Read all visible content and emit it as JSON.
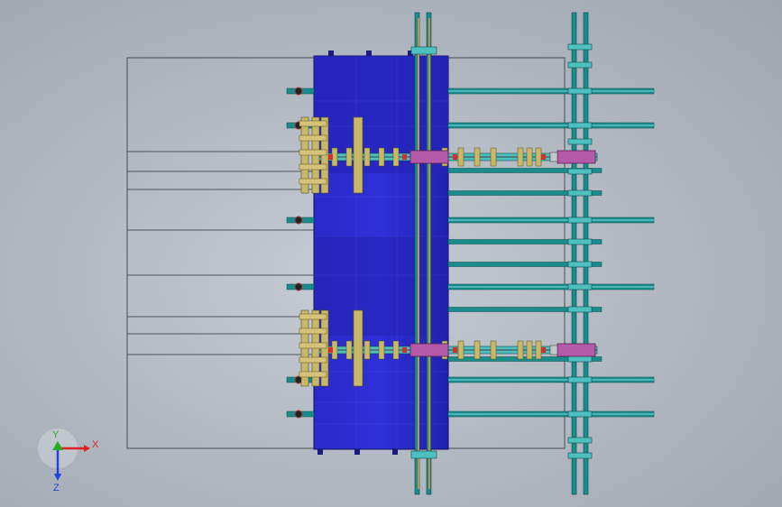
{
  "viewport": {
    "background": "#b8bec7",
    "model_colors": {
      "block": "#2525c8",
      "rail": "#1a8c8c",
      "rail_light": "#4fc0c0",
      "carriage": "#c8b86a",
      "slider": "#b45aa8",
      "wire": "#3a3f46"
    }
  },
  "triad": {
    "x_label": "X",
    "y_label": "Y",
    "z_label": "Z",
    "x_color": "#e02020",
    "y_color": "#20b020",
    "z_color": "#2040e0"
  }
}
